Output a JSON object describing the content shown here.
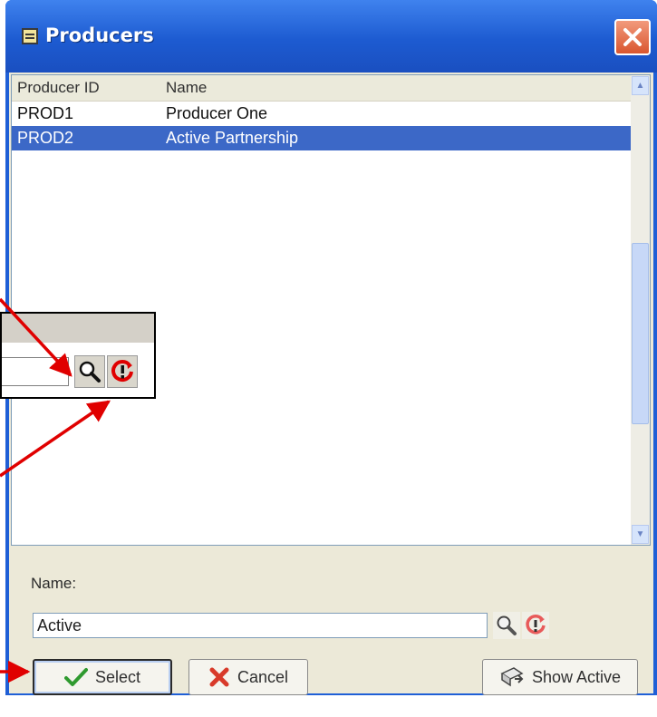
{
  "window": {
    "title": "Producers",
    "icons": {
      "title": "window-icon",
      "close": "close-icon"
    }
  },
  "list": {
    "columns": [
      "Producer ID",
      "Name"
    ],
    "rows": [
      {
        "id": "PROD1",
        "name": "Producer One",
        "selected": false
      },
      {
        "id": "PROD2",
        "name": "Active Partnership",
        "selected": true
      }
    ],
    "selection_color": "#3c68c7"
  },
  "filter": {
    "label": "Name:",
    "value": "Active",
    "icons": {
      "search": "search-icon",
      "reset": "reset-icon"
    }
  },
  "buttons": {
    "select": "Select",
    "cancel": "Cancel",
    "show_active": "Show Active",
    "icons": {
      "select": "checkmark-icon",
      "cancel": "cancel-x-icon",
      "show_active": "show-active-icon"
    }
  },
  "callout": {
    "icons": {
      "search": "search-icon",
      "reset": "reset-icon"
    },
    "arrow_color": "#e00000"
  },
  "colors": {
    "titlebar": "#1f5fd6",
    "dialog_bg": "#ece9d8"
  }
}
